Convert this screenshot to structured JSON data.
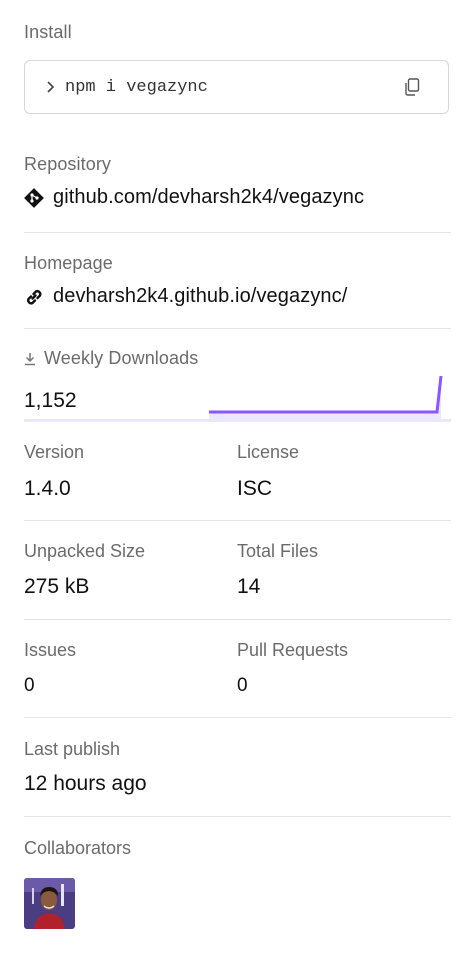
{
  "install": {
    "label": "Install",
    "command": "npm i vegazync"
  },
  "repository": {
    "label": "Repository",
    "link": "github.com/devharsh2k4/vegazync"
  },
  "homepage": {
    "label": "Homepage",
    "link": "devharsh2k4.github.io/vegazync/"
  },
  "weekly_downloads": {
    "label": "Weekly Downloads",
    "count": "1,152"
  },
  "stats": {
    "version_label": "Version",
    "version_value": "1.4.0",
    "license_label": "License",
    "license_value": "ISC",
    "unpacked_size_label": "Unpacked Size",
    "unpacked_size_value": "275 kB",
    "total_files_label": "Total Files",
    "total_files_value": "14",
    "issues_label": "Issues",
    "issues_value": "0",
    "pull_requests_label": "Pull Requests",
    "pull_requests_value": "0",
    "last_publish_label": "Last publish",
    "last_publish_value": "12 hours ago"
  },
  "collaborators": {
    "label": "Collaborators"
  },
  "colors": {
    "accent": "#8956ff",
    "text": "#111111",
    "muted": "#6b6b6b",
    "divider": "#e4e4e4"
  },
  "icons": {
    "prompt": "chevron-right-icon",
    "copy": "copy-icon",
    "repository": "git-icon",
    "homepage": "link-icon",
    "downloads": "download-icon"
  }
}
